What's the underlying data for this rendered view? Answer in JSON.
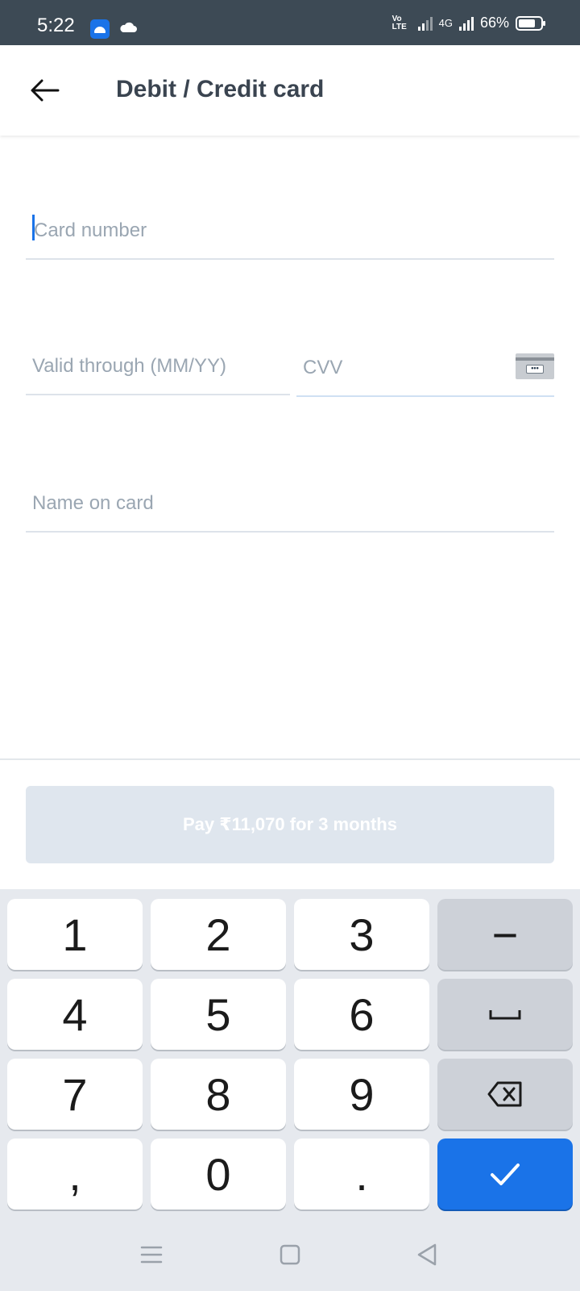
{
  "status_bar": {
    "time": "5:22",
    "volte": "Vo LTE",
    "network": "4G",
    "battery": "66%"
  },
  "header": {
    "title": "Debit / Credit card",
    "back_icon": "arrow-left-icon"
  },
  "form": {
    "card_number": {
      "placeholder": "Card number",
      "value": ""
    },
    "valid_through": {
      "placeholder": "Valid through (MM/YY)",
      "value": ""
    },
    "cvv": {
      "placeholder": "CVV",
      "value": "",
      "icon": "card-cvv-icon",
      "icon_text": "•••"
    },
    "name_on_card": {
      "placeholder": "Name on card",
      "value": ""
    }
  },
  "pay_button": {
    "label": "Pay ₹11,070 for 3 months",
    "enabled": false
  },
  "keypad": {
    "keys": [
      "1",
      "2",
      "3",
      "−",
      "4",
      "5",
      "6",
      "␣",
      "7",
      "8",
      "9",
      "⌫",
      ",",
      "0",
      ".",
      "✓"
    ]
  },
  "nav": {
    "recent_icon": "menu-icon",
    "home_icon": "home-square-icon",
    "back_icon": "back-triangle-icon"
  },
  "colors": {
    "status_bar": "#3d4a55",
    "accent": "#1a73e8",
    "disabled_button": "#dfe6ee",
    "keypad_bg": "#e6e9ee"
  }
}
